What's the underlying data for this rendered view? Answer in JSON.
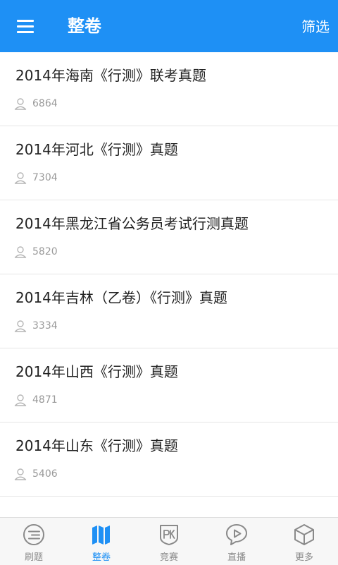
{
  "header": {
    "title": "整卷",
    "filter_label": "筛选"
  },
  "colors": {
    "accent": "#1E90F5",
    "icon_gray": "#8a8a8a",
    "count_gray": "#9a9a9a"
  },
  "papers": [
    {
      "title": "2014年海南《行测》联考真题",
      "count": "6864"
    },
    {
      "title": "2014年河北《行测》真题",
      "count": "7304"
    },
    {
      "title": "2014年黑龙江省公务员考试行测真题",
      "count": "5820"
    },
    {
      "title": "2014年吉林（乙卷）《行测》真题",
      "count": "3334"
    },
    {
      "title": "2014年山西《行测》真题",
      "count": "4871"
    },
    {
      "title": "2014年山东《行测》真题",
      "count": "5406"
    }
  ],
  "tabbar": {
    "items": [
      {
        "label": "刷题",
        "icon": "practice-icon"
      },
      {
        "label": "整卷",
        "icon": "book-icon",
        "active": true
      },
      {
        "label": "竞赛",
        "icon": "pk-icon"
      },
      {
        "label": "直播",
        "icon": "live-icon"
      },
      {
        "label": "更多",
        "icon": "more-cube-icon"
      }
    ]
  }
}
